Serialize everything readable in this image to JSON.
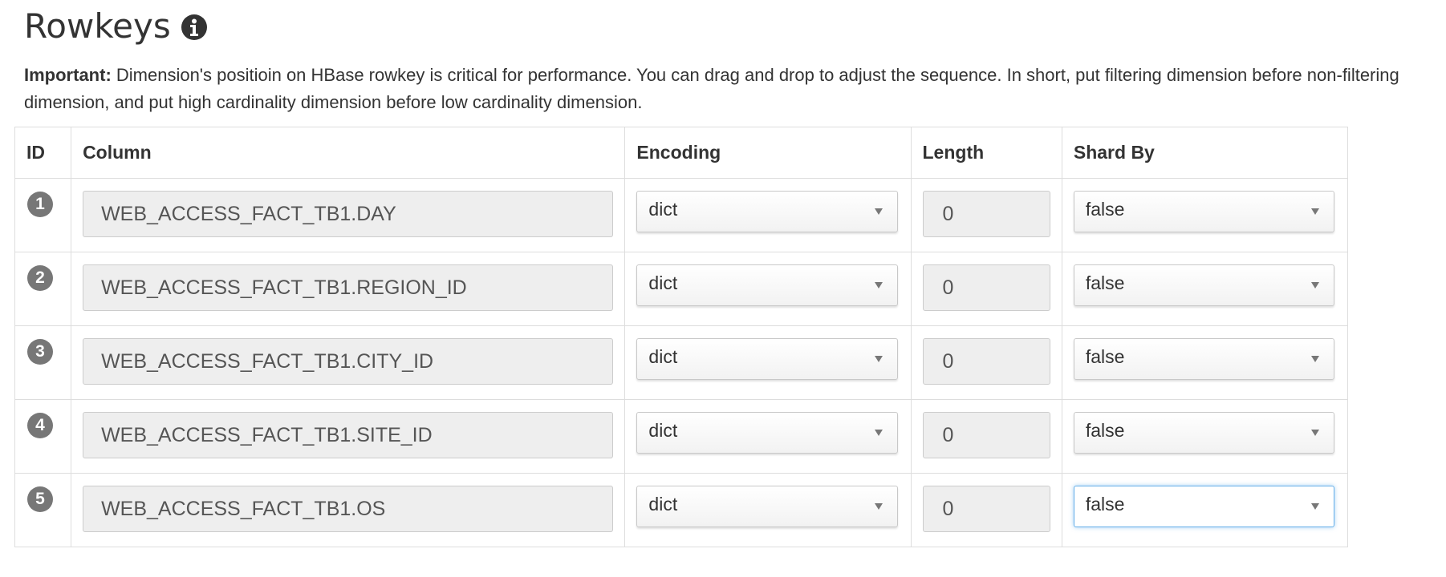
{
  "header": {
    "title": "Rowkeys",
    "info_icon": "info-circle"
  },
  "note": {
    "prefix": "Important:",
    "text": " Dimension's positioin on HBase rowkey is critical for performance. You can drag and drop to adjust the sequence. In short, put filtering dimension before non-filtering dimension, and put high cardinality dimension before low cardinality dimension."
  },
  "table": {
    "headers": {
      "id": "ID",
      "column": "Column",
      "encoding": "Encoding",
      "length": "Length",
      "shard_by": "Shard By"
    },
    "rows": [
      {
        "id": "1",
        "column": "WEB_ACCESS_FACT_TB1.DAY",
        "encoding": "dict",
        "length": "0",
        "shard_by": "false"
      },
      {
        "id": "2",
        "column": "WEB_ACCESS_FACT_TB1.REGION_ID",
        "encoding": "dict",
        "length": "0",
        "shard_by": "false"
      },
      {
        "id": "3",
        "column": "WEB_ACCESS_FACT_TB1.CITY_ID",
        "encoding": "dict",
        "length": "0",
        "shard_by": "false"
      },
      {
        "id": "4",
        "column": "WEB_ACCESS_FACT_TB1.SITE_ID",
        "encoding": "dict",
        "length": "0",
        "shard_by": "false"
      },
      {
        "id": "5",
        "column": "WEB_ACCESS_FACT_TB1.OS",
        "encoding": "dict",
        "length": "0",
        "shard_by": "false"
      }
    ]
  },
  "colors": {
    "badge": "#777777",
    "focus": "#66afe9"
  }
}
